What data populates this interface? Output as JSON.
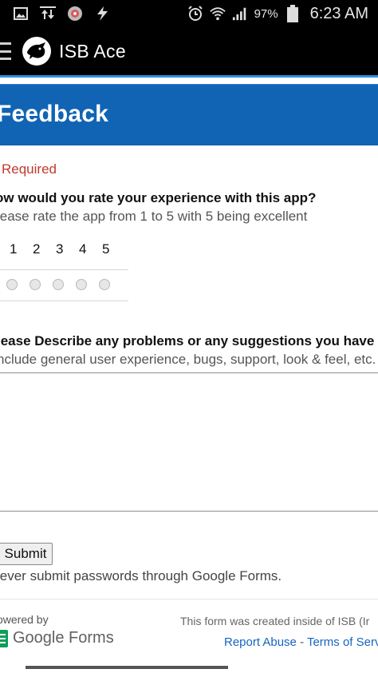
{
  "status_bar": {
    "icons_left": [
      "image-icon",
      "sync-icon",
      "avatar-icon",
      "flash-icon"
    ],
    "icons_right": [
      "alarm-icon",
      "wifi-icon",
      "signal-icon",
      "battery-icon"
    ],
    "battery": "97%",
    "time": "6:23 AM"
  },
  "app_bar": {
    "title": "ISB Ace"
  },
  "form": {
    "title": "Feedback",
    "required_note": "Required",
    "question1": {
      "title": "ow would you rate your experience with this app?",
      "help": "lease rate the app from 1 to 5 with 5 being excellent",
      "scale": [
        "1",
        "2",
        "3",
        "4",
        "5"
      ]
    },
    "question2": {
      "title": "lease Describe any problems or any suggestions you have for",
      "help": "nclude general user experience, bugs, support, look & feel, etc.",
      "value": ""
    },
    "submit_label": "Submit",
    "password_note": "lever submit passwords through Google Forms."
  },
  "footer": {
    "powered_by": "owered by",
    "google_forms": "Google Forms",
    "created_text": "This form was created inside of ISB (Ir",
    "report_abuse": "Report Abuse",
    "separator": " - ",
    "terms": "Terms of Servi"
  },
  "colors": {
    "header_blue": "#1164b4",
    "required_red": "#c0392b",
    "link_blue": "#1565c0"
  }
}
